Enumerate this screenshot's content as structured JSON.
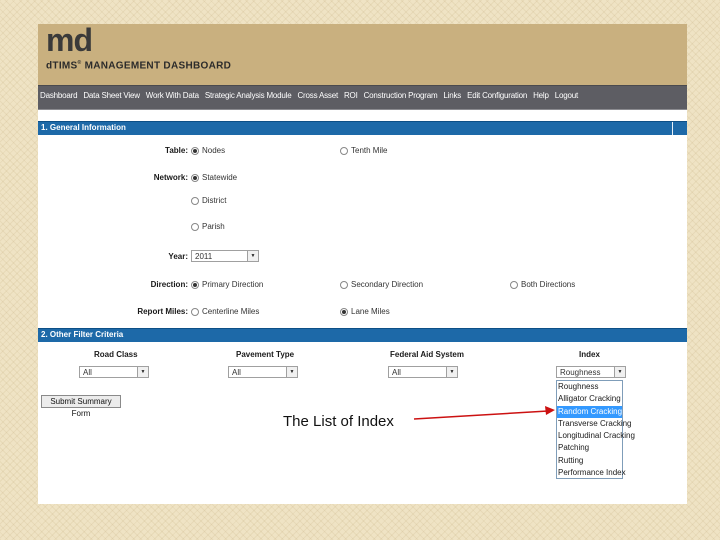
{
  "header": {
    "logo": "md",
    "title_prefix": "dTIMS",
    "title_reg": "®",
    "title_main": "MANAGEMENT DASHBOARD"
  },
  "nav": {
    "items": [
      "Dashboard",
      "Data Sheet View",
      "Work With Data",
      "Strategic Analysis Module",
      "Cross Asset",
      "ROI",
      "Construction Program",
      "Links",
      "Edit Configuration",
      "Help",
      "Logout"
    ]
  },
  "section1": {
    "title": "1. General Information",
    "table": {
      "label": "Table:",
      "options": [
        "Nodes",
        "Tenth Mile"
      ],
      "selected": "Nodes"
    },
    "network": {
      "label": "Network:",
      "options": [
        "Statewide",
        "District",
        "Parish"
      ],
      "selected": "Statewide"
    },
    "year": {
      "label": "Year:",
      "value": "2011"
    },
    "direction": {
      "label": "Direction:",
      "options": [
        "Primary Direction",
        "Secondary Direction",
        "Both Directions"
      ],
      "selected": "Primary Direction"
    },
    "report_miles": {
      "label": "Report Miles:",
      "options": [
        "Centerline Miles",
        "Lane Miles"
      ],
      "selected": "Lane Miles"
    }
  },
  "section2": {
    "title": "2. Other Filter Criteria",
    "road_class": {
      "label": "Road Class",
      "value": "All"
    },
    "pavement_type": {
      "label": "Pavement Type",
      "value": "All"
    },
    "federal_aid": {
      "label": "Federal Aid System",
      "value": "All"
    },
    "index": {
      "label": "Index",
      "value": "Roughness",
      "options": [
        "Roughness",
        "Alligator Cracking",
        "Random Cracking",
        "Transverse Cracking",
        "Longitudinal Cracking",
        "Patching",
        "Rutting",
        "Performance Index"
      ],
      "highlighted": "Random Cracking"
    }
  },
  "submit_label": "Submit Summary Form",
  "annotation": {
    "caption": "The List of Index",
    "arrow_color": "#cc1111"
  }
}
